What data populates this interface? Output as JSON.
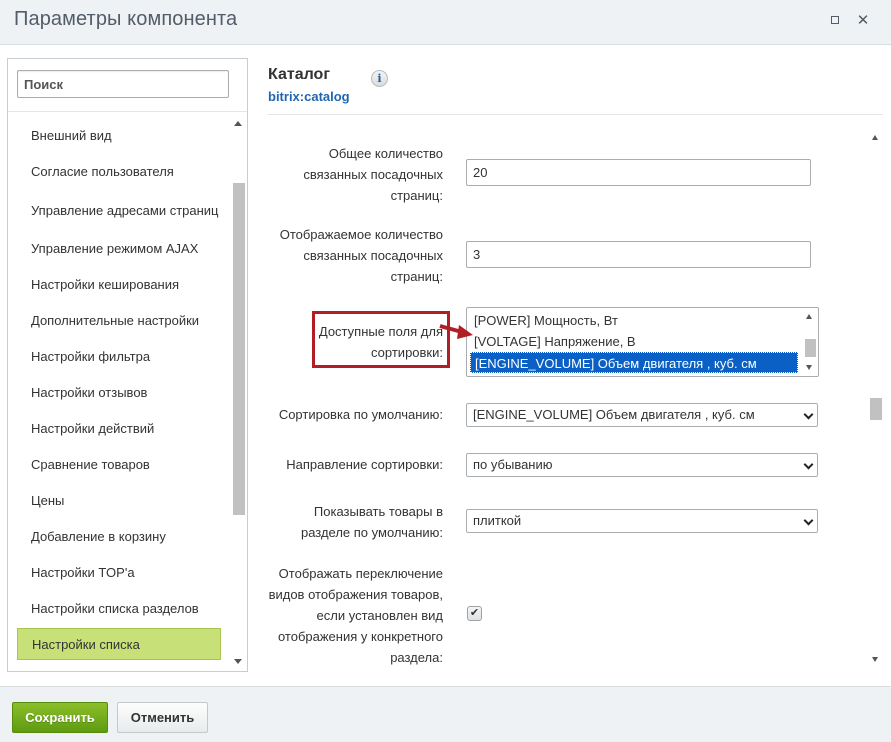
{
  "window": {
    "title": "Параметры компонента"
  },
  "sidebar": {
    "search_placeholder": "Поиск",
    "items": [
      {
        "label": "Внешний вид"
      },
      {
        "label": "Согласие пользователя"
      },
      {
        "label": "Управление адресами страниц"
      },
      {
        "label": "Управление режимом AJAX"
      },
      {
        "label": "Настройки кеширования"
      },
      {
        "label": "Дополнительные настройки"
      },
      {
        "label": "Настройки фильтра"
      },
      {
        "label": "Настройки отзывов"
      },
      {
        "label": "Настройки действий"
      },
      {
        "label": "Сравнение товаров"
      },
      {
        "label": "Цены"
      },
      {
        "label": "Добавление в корзину"
      },
      {
        "label": "Настройки TOP'а"
      },
      {
        "label": "Настройки списка разделов"
      },
      {
        "label": "Настройки списка",
        "active": true
      }
    ]
  },
  "header": {
    "title": "Каталог",
    "subtitle": "bitrix:catalog",
    "info_icon": "info-icon"
  },
  "form": {
    "total_landing_label": "Общее количество связанных посадочных страниц:",
    "total_landing_value": "20",
    "shown_landing_label": "Отображаемое количество связанных посадочных страниц:",
    "shown_landing_value": "3",
    "sort_fields_label": "Доступные поля для сортировки:",
    "sort_fields_options": [
      {
        "label": "[POWER] Мощность, Вт",
        "selected": false
      },
      {
        "label": "[VOLTAGE] Напряжение, В",
        "selected": false
      },
      {
        "label": "[ENGINE_VOLUME] Объем двигателя , куб. см",
        "selected": true
      }
    ],
    "default_sort_label": "Сортировка по умолчанию:",
    "default_sort_value": "[ENGINE_VOLUME] Объем двигателя , куб. см",
    "sort_dir_label": "Направление сортировки:",
    "sort_dir_value": "по убыванию",
    "view_label": "Показывать товары в разделе по умолчанию:",
    "view_value": "плиткой",
    "switch_label": "Отображать переключение видов отображения товаров, если установлен вид отображения у конкретного раздела:",
    "switch_checked": true
  },
  "footer": {
    "save_label": "Сохранить",
    "cancel_label": "Отменить"
  },
  "colors": {
    "accent_green": "#7cb321",
    "active_item": "#c7e078",
    "selection_blue": "#0a60c4",
    "annotation_red": "#b11e23",
    "link_blue": "#2067b0"
  }
}
